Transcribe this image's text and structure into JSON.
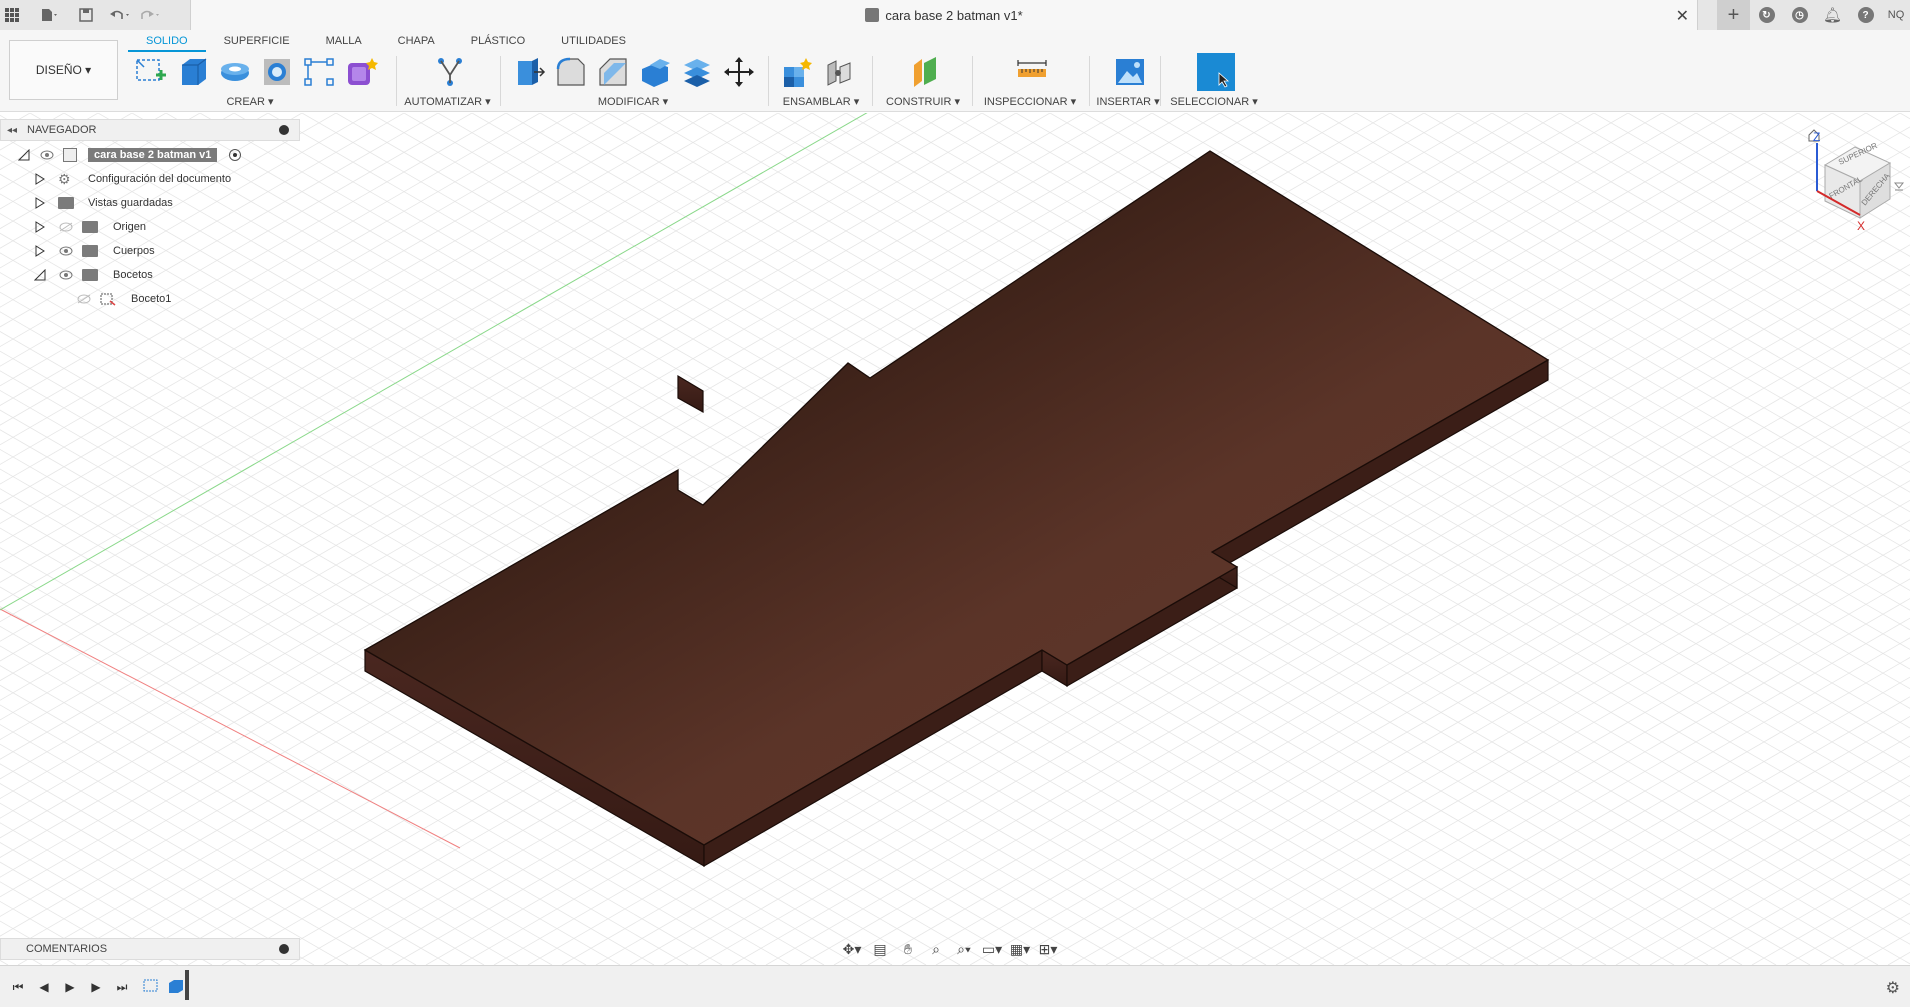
{
  "titlebar": {
    "document_title": "cara base 2 batman v1*",
    "user_initials": "NQ"
  },
  "toolbar": {
    "workspace": "DISEÑO ▾",
    "tabs": [
      "SOLIDO",
      "SUPERFICIE",
      "MALLA",
      "CHAPA",
      "PLÁSTICO",
      "UTILIDADES"
    ],
    "active_tab": "SOLIDO",
    "groups": {
      "crear": "CREAR ▾",
      "automatizar": "AUTOMATIZAR ▾",
      "modificar": "MODIFICAR ▾",
      "ensamblar": "ENSAMBLAR ▾",
      "construir": "CONSTRUIR ▾",
      "inspeccionar": "INSPECCIONAR ▾",
      "insertar": "INSERTAR ▾",
      "seleccionar": "SELECCIONAR ▾"
    }
  },
  "browser": {
    "title": "NAVEGADOR",
    "root": "cara base 2 batman v1",
    "items": [
      {
        "label": "Configuración del documento",
        "icon": "gear-icon"
      },
      {
        "label": "Vistas guardadas",
        "icon": "folder-icon"
      },
      {
        "label": "Origen",
        "icon": "folder-icon"
      },
      {
        "label": "Cuerpos",
        "icon": "folder-icon"
      },
      {
        "label": "Bocetos",
        "icon": "folder-icon"
      },
      {
        "label": "Boceto1",
        "icon": "sketch-icon"
      }
    ]
  },
  "comments": {
    "title": "COMENTARIOS"
  },
  "viewcube": {
    "top": "SUPERIOR",
    "front": "FRONTAL",
    "right": "DERECHA",
    "axis_z": "Z",
    "axis_x": "X"
  },
  "colors": {
    "accent": "#0696d7",
    "body_top": "#5a3328",
    "body_side": "#3e2019"
  }
}
